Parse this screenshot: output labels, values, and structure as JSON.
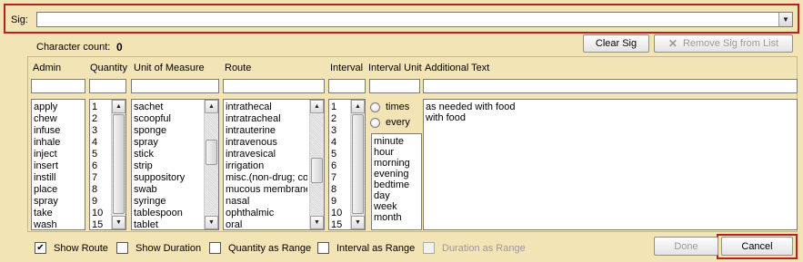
{
  "sig": {
    "label": "Sig:",
    "value": ""
  },
  "character_count": {
    "label": "Character count:",
    "value": "0"
  },
  "buttons": {
    "clear_sig": "Clear Sig",
    "remove_sig": "Remove Sig from List",
    "done": "Done",
    "cancel": "Cancel"
  },
  "columns": {
    "admin": "Admin",
    "quantity": "Quantity",
    "unit_of_measure": "Unit of Measure",
    "route": "Route",
    "interval": "Interval",
    "interval_unit": "Interval Unit",
    "additional_text": "Additional Text"
  },
  "lists": {
    "admin": [
      "apply",
      "chew",
      "infuse",
      "inhale",
      "inject",
      "insert",
      "instill",
      "place",
      "spray",
      "take",
      "wash"
    ],
    "quantity": [
      "1",
      "2",
      "3",
      "4",
      "5",
      "6",
      "7",
      "8",
      "9",
      "10",
      "15"
    ],
    "unit_of_measure": [
      "sachet",
      "scoopful",
      "sponge",
      "spray",
      "stick",
      "strip",
      "suppository",
      "swab",
      "syringe",
      "tablespoon",
      "tablet"
    ],
    "route": [
      "intrathecal",
      "intratracheal",
      "intrauterine",
      "intravenous",
      "intravesical",
      "irrigation",
      "misc.(non-drug; con",
      "mucous membrane",
      "nasal",
      "ophthalmic",
      "oral"
    ],
    "interval": [
      "1",
      "2",
      "3",
      "4",
      "5",
      "6",
      "7",
      "8",
      "9",
      "10",
      "15"
    ],
    "interval_unit": [
      "minute",
      "hour",
      "morning",
      "evening",
      "bedtime",
      "day",
      "week",
      "month"
    ],
    "additional_text": [
      "as needed with food",
      "with food"
    ]
  },
  "interval_radios": {
    "times": "times",
    "every": "every"
  },
  "options": {
    "show_route": {
      "label": "Show Route",
      "checked": true
    },
    "show_duration": {
      "label": "Show Duration",
      "checked": false
    },
    "quantity_as_range": {
      "label": "Quantity as Range",
      "checked": false
    },
    "interval_as_range": {
      "label": "Interval as Range",
      "checked": false
    },
    "duration_as_range": {
      "label": "Duration as Range",
      "checked": false,
      "disabled": true
    }
  },
  "icons": {
    "dropdown": "chevron-down-icon",
    "remove": "x-icon",
    "scroll_up": "arrow-up-icon",
    "scroll_down": "arrow-down-icon",
    "checkmark": "check-icon"
  },
  "colors": {
    "background": "#f3e4b6",
    "highlight_frame": "#b8211d"
  }
}
